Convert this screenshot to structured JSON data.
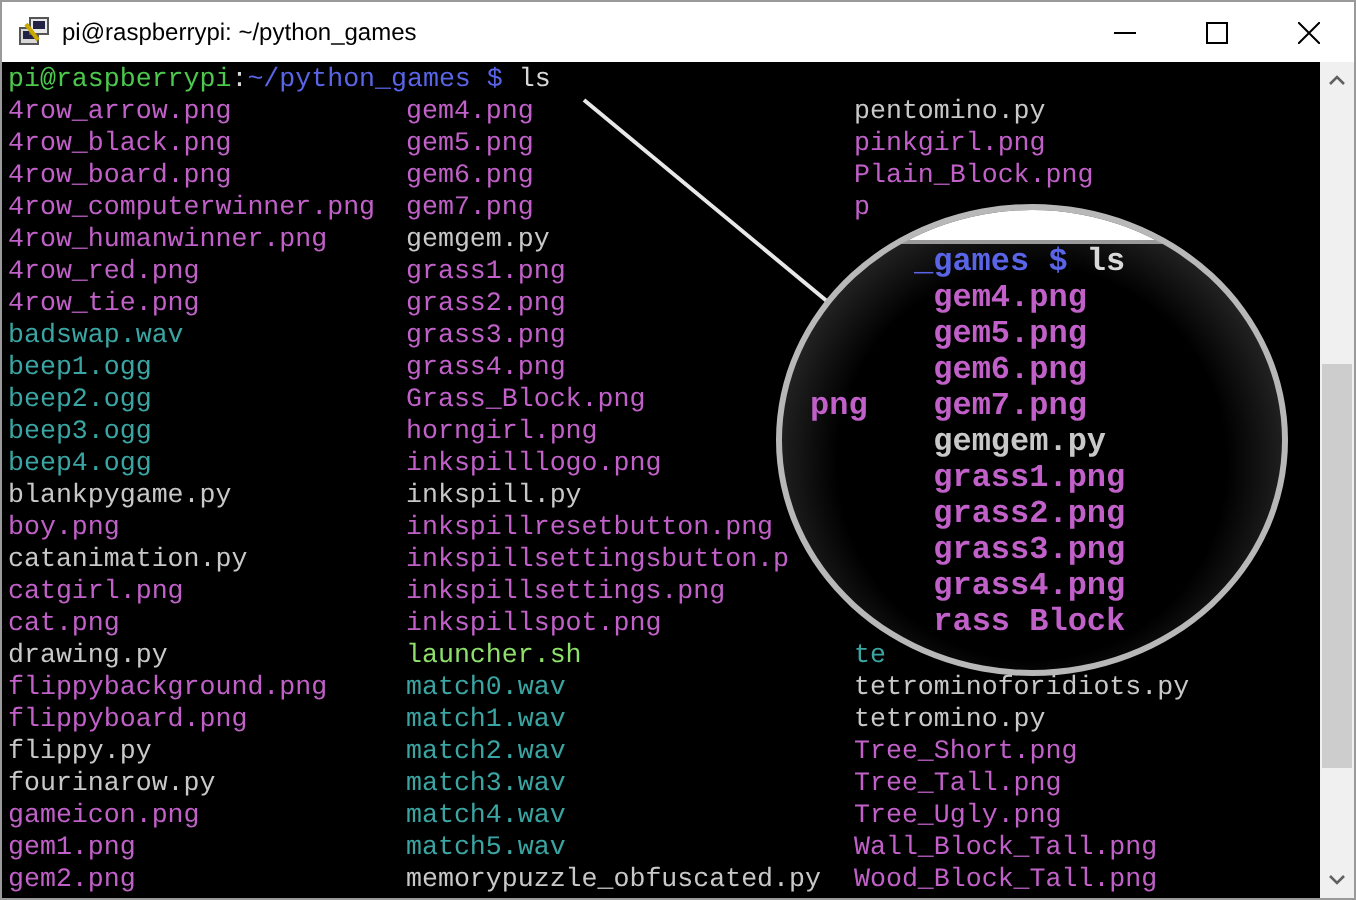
{
  "window": {
    "title": "pi@raspberrypi: ~/python_games"
  },
  "prompt": {
    "user_host": "pi@raspberrypi",
    "separator": ":",
    "path": "~/python_games $",
    "command": "ls"
  },
  "column_1": [
    {
      "text": "4row_arrow.png",
      "kind": "image"
    },
    {
      "text": "4row_black.png",
      "kind": "image"
    },
    {
      "text": "4row_board.png",
      "kind": "image"
    },
    {
      "text": "4row_computerwinner.png",
      "kind": "image"
    },
    {
      "text": "4row_humanwinner.png",
      "kind": "image"
    },
    {
      "text": "4row_red.png",
      "kind": "image"
    },
    {
      "text": "4row_tie.png",
      "kind": "image"
    },
    {
      "text": "badswap.wav",
      "kind": "sound"
    },
    {
      "text": "beep1.ogg",
      "kind": "sound"
    },
    {
      "text": "beep2.ogg",
      "kind": "sound"
    },
    {
      "text": "beep3.ogg",
      "kind": "sound"
    },
    {
      "text": "beep4.ogg",
      "kind": "sound"
    },
    {
      "text": "blankpygame.py",
      "kind": "script"
    },
    {
      "text": "boy.png",
      "kind": "image"
    },
    {
      "text": "catanimation.py",
      "kind": "script"
    },
    {
      "text": "catgirl.png",
      "kind": "image"
    },
    {
      "text": "cat.png",
      "kind": "image"
    },
    {
      "text": "drawing.py",
      "kind": "script"
    },
    {
      "text": "flippybackground.png",
      "kind": "image"
    },
    {
      "text": "flippyboard.png",
      "kind": "image"
    },
    {
      "text": "flippy.py",
      "kind": "script"
    },
    {
      "text": "fourinarow.py",
      "kind": "script"
    },
    {
      "text": "gameicon.png",
      "kind": "image"
    },
    {
      "text": "gem1.png",
      "kind": "image"
    },
    {
      "text": "gem2.png",
      "kind": "image"
    }
  ],
  "column_2": [
    {
      "text": "gem4.png",
      "kind": "image"
    },
    {
      "text": "gem5.png",
      "kind": "image"
    },
    {
      "text": "gem6.png",
      "kind": "image"
    },
    {
      "text": "gem7.png",
      "kind": "image"
    },
    {
      "text": "gemgem.py",
      "kind": "script"
    },
    {
      "text": "grass1.png",
      "kind": "image"
    },
    {
      "text": "grass2.png",
      "kind": "image"
    },
    {
      "text": "grass3.png",
      "kind": "image"
    },
    {
      "text": "grass4.png",
      "kind": "image"
    },
    {
      "text": "Grass_Block.png",
      "kind": "image"
    },
    {
      "text": "horngirl.png",
      "kind": "image"
    },
    {
      "text": "inkspilllogo.png",
      "kind": "image"
    },
    {
      "text": "inkspill.py",
      "kind": "script"
    },
    {
      "text": "inkspillresetbutton.png",
      "kind": "image"
    },
    {
      "text": "inkspillsettingsbutton.p",
      "kind": "image"
    },
    {
      "text": "inkspillsettings.png",
      "kind": "image"
    },
    {
      "text": "inkspillspot.png",
      "kind": "image"
    },
    {
      "text": "launcher.sh",
      "kind": "executable"
    },
    {
      "text": "match0.wav",
      "kind": "sound"
    },
    {
      "text": "match1.wav",
      "kind": "sound"
    },
    {
      "text": "match2.wav",
      "kind": "sound"
    },
    {
      "text": "match3.wav",
      "kind": "sound"
    },
    {
      "text": "match4.wav",
      "kind": "sound"
    },
    {
      "text": "match5.wav",
      "kind": "sound"
    },
    {
      "text": "memorypuzzle_obfuscated.py",
      "kind": "script"
    }
  ],
  "column_3_top": [
    {
      "text": "pentomino.py",
      "kind": "script"
    },
    {
      "text": "pinkgirl.png",
      "kind": "image"
    },
    {
      "text": "Plain_Block.png",
      "kind": "image"
    },
    {
      "text": "p",
      "kind": "image"
    }
  ],
  "column_3_bottom": [
    {
      "text": "te",
      "kind": "sound"
    },
    {
      "text": "tetrominoforidiots.py",
      "kind": "script"
    },
    {
      "text": "tetromino.py",
      "kind": "script"
    },
    {
      "text": "Tree_Short.png",
      "kind": "image"
    },
    {
      "text": "Tree_Tall.png",
      "kind": "image"
    },
    {
      "text": "Tree_Ugly.png",
      "kind": "image"
    },
    {
      "text": "Wall_Block_Tall.png",
      "kind": "image"
    },
    {
      "text": "Wood_Block_Tall.png",
      "kind": "image"
    }
  ],
  "magnifier": {
    "prompt_path": "_games $",
    "prompt_command": "ls",
    "lines": [
      {
        "text": "gem4.png",
        "kind": "image"
      },
      {
        "text": "gem5.png",
        "kind": "image"
      },
      {
        "text": "gem6.png",
        "kind": "image"
      },
      {
        "text": "gem7.png",
        "kind": "image",
        "left": "png"
      },
      {
        "text": "gemgem.py",
        "kind": "script"
      },
      {
        "text": "grass1.png",
        "kind": "image"
      },
      {
        "text": "grass2.png",
        "kind": "image"
      },
      {
        "text": "grass3.png",
        "kind": "image"
      },
      {
        "text": "grass4.png",
        "kind": "image"
      },
      {
        "text": "rass Block",
        "kind": "image"
      }
    ]
  }
}
